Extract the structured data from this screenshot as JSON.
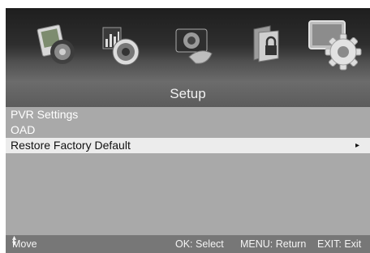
{
  "header_icons": [
    {
      "name": "picture-icon",
      "selected": false
    },
    {
      "name": "sound-icon",
      "selected": false
    },
    {
      "name": "channel-icon",
      "selected": false
    },
    {
      "name": "lock-icon",
      "selected": false
    },
    {
      "name": "setup-gear-icon",
      "selected": true
    }
  ],
  "title": "Setup",
  "menu_items": [
    {
      "label": "PVR Settings",
      "selected": false
    },
    {
      "label": "OAD",
      "selected": false
    },
    {
      "label": "Restore Factory Default",
      "selected": true,
      "arrow": "▸"
    }
  ],
  "footer": {
    "move": "Move",
    "select": "OK: Select",
    "return": "MENU: Return",
    "exit": "EXIT: Exit"
  },
  "colors": {
    "panel": "#a9a9a9",
    "title_bar": "#626262",
    "highlight": "#ececec",
    "footer": "#777777"
  }
}
